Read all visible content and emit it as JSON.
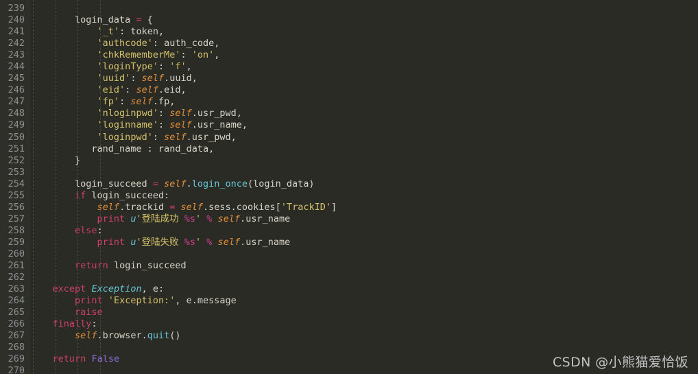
{
  "editor": {
    "language": "Python",
    "theme": {
      "background": "#2b2b26",
      "gutter_background": "#2f2f2a",
      "line_number_color": "#8e9191",
      "default_text": "#d7d4c8",
      "keyword": "#cc3f6a",
      "string": "#d3c16a",
      "self_keyword": "#e08f3c",
      "function_call": "#66c6d6",
      "class_name": "#66c6d6",
      "constant": "#8b6bd6",
      "format_spec": "#cc3f8a",
      "indent_guide": "#4a4a42"
    },
    "first_line_number": 239,
    "last_line_number": 270,
    "indent_guide_columns": [
      0,
      4,
      8,
      12
    ]
  },
  "lines": [
    {
      "number": "239",
      "tokens": []
    },
    {
      "number": "240",
      "tokens": [
        {
          "t": "        ",
          "c": "t-plain"
        },
        {
          "t": "login_data ",
          "c": "t-plain"
        },
        {
          "t": "=",
          "c": "t-op"
        },
        {
          "t": " {",
          "c": "t-plain"
        }
      ]
    },
    {
      "number": "241",
      "tokens": [
        {
          "t": "            ",
          "c": "t-plain"
        },
        {
          "t": "'_t'",
          "c": "t-str"
        },
        {
          "t": ": token,",
          "c": "t-plain"
        }
      ]
    },
    {
      "number": "242",
      "tokens": [
        {
          "t": "            ",
          "c": "t-plain"
        },
        {
          "t": "'authcode'",
          "c": "t-str"
        },
        {
          "t": ": auth_code,",
          "c": "t-plain"
        }
      ]
    },
    {
      "number": "243",
      "tokens": [
        {
          "t": "            ",
          "c": "t-plain"
        },
        {
          "t": "'chkRememberMe'",
          "c": "t-str"
        },
        {
          "t": ": ",
          "c": "t-plain"
        },
        {
          "t": "'on'",
          "c": "t-str"
        },
        {
          "t": ",",
          "c": "t-plain"
        }
      ]
    },
    {
      "number": "244",
      "tokens": [
        {
          "t": "            ",
          "c": "t-plain"
        },
        {
          "t": "'loginType'",
          "c": "t-str"
        },
        {
          "t": ": ",
          "c": "t-plain"
        },
        {
          "t": "'f'",
          "c": "t-str"
        },
        {
          "t": ",",
          "c": "t-plain"
        }
      ]
    },
    {
      "number": "245",
      "tokens": [
        {
          "t": "            ",
          "c": "t-plain"
        },
        {
          "t": "'uuid'",
          "c": "t-str"
        },
        {
          "t": ": ",
          "c": "t-plain"
        },
        {
          "t": "self",
          "c": "t-self"
        },
        {
          "t": ".uuid,",
          "c": "t-plain"
        }
      ]
    },
    {
      "number": "246",
      "tokens": [
        {
          "t": "            ",
          "c": "t-plain"
        },
        {
          "t": "'eid'",
          "c": "t-str"
        },
        {
          "t": ": ",
          "c": "t-plain"
        },
        {
          "t": "self",
          "c": "t-self"
        },
        {
          "t": ".eid,",
          "c": "t-plain"
        }
      ]
    },
    {
      "number": "247",
      "tokens": [
        {
          "t": "            ",
          "c": "t-plain"
        },
        {
          "t": "'fp'",
          "c": "t-str"
        },
        {
          "t": ": ",
          "c": "t-plain"
        },
        {
          "t": "self",
          "c": "t-self"
        },
        {
          "t": ".fp,",
          "c": "t-plain"
        }
      ]
    },
    {
      "number": "248",
      "tokens": [
        {
          "t": "            ",
          "c": "t-plain"
        },
        {
          "t": "'nloginpwd'",
          "c": "t-str"
        },
        {
          "t": ": ",
          "c": "t-plain"
        },
        {
          "t": "self",
          "c": "t-self"
        },
        {
          "t": ".usr_pwd,",
          "c": "t-plain"
        }
      ]
    },
    {
      "number": "249",
      "tokens": [
        {
          "t": "            ",
          "c": "t-plain"
        },
        {
          "t": "'loginname'",
          "c": "t-str"
        },
        {
          "t": ": ",
          "c": "t-plain"
        },
        {
          "t": "self",
          "c": "t-self"
        },
        {
          "t": ".usr_name,",
          "c": "t-plain"
        }
      ]
    },
    {
      "number": "250",
      "tokens": [
        {
          "t": "            ",
          "c": "t-plain"
        },
        {
          "t": "'loginpwd'",
          "c": "t-str"
        },
        {
          "t": ": ",
          "c": "t-plain"
        },
        {
          "t": "self",
          "c": "t-self"
        },
        {
          "t": ".usr_pwd,",
          "c": "t-plain"
        }
      ]
    },
    {
      "number": "251",
      "tokens": [
        {
          "t": "           rand_name : rand_data,",
          "c": "t-plain"
        }
      ]
    },
    {
      "number": "252",
      "tokens": [
        {
          "t": "        }",
          "c": "t-plain"
        }
      ]
    },
    {
      "number": "253",
      "tokens": []
    },
    {
      "number": "254",
      "tokens": [
        {
          "t": "        login_succeed ",
          "c": "t-plain"
        },
        {
          "t": "=",
          "c": "t-op"
        },
        {
          "t": " ",
          "c": "t-plain"
        },
        {
          "t": "self",
          "c": "t-self"
        },
        {
          "t": ".",
          "c": "t-plain"
        },
        {
          "t": "login_once",
          "c": "t-fn"
        },
        {
          "t": "(login_data)",
          "c": "t-plain"
        }
      ]
    },
    {
      "number": "255",
      "tokens": [
        {
          "t": "        ",
          "c": "t-plain"
        },
        {
          "t": "if",
          "c": "t-kw"
        },
        {
          "t": " login_succeed:",
          "c": "t-plain"
        }
      ]
    },
    {
      "number": "256",
      "tokens": [
        {
          "t": "            ",
          "c": "t-plain"
        },
        {
          "t": "self",
          "c": "t-self"
        },
        {
          "t": ".trackid ",
          "c": "t-plain"
        },
        {
          "t": "=",
          "c": "t-op"
        },
        {
          "t": " ",
          "c": "t-plain"
        },
        {
          "t": "self",
          "c": "t-self"
        },
        {
          "t": ".sess.cookies[",
          "c": "t-plain"
        },
        {
          "t": "'TrackID'",
          "c": "t-str"
        },
        {
          "t": "]",
          "c": "t-plain"
        }
      ]
    },
    {
      "number": "257",
      "tokens": [
        {
          "t": "            ",
          "c": "t-plain"
        },
        {
          "t": "print",
          "c": "t-kw"
        },
        {
          "t": " ",
          "c": "t-plain"
        },
        {
          "t": "u",
          "c": "t-uprefix"
        },
        {
          "t": "'",
          "c": "t-str"
        },
        {
          "t": "登陆成功",
          "c": "t-str t-cjk"
        },
        {
          "t": " ",
          "c": "t-str"
        },
        {
          "t": "%s",
          "c": "t-fmt"
        },
        {
          "t": "'",
          "c": "t-str"
        },
        {
          "t": " ",
          "c": "t-plain"
        },
        {
          "t": "%",
          "c": "t-fmt"
        },
        {
          "t": " ",
          "c": "t-plain"
        },
        {
          "t": "self",
          "c": "t-self"
        },
        {
          "t": ".usr_name",
          "c": "t-plain"
        }
      ]
    },
    {
      "number": "258",
      "tokens": [
        {
          "t": "        ",
          "c": "t-plain"
        },
        {
          "t": "else",
          "c": "t-kw"
        },
        {
          "t": ":",
          "c": "t-plain"
        }
      ]
    },
    {
      "number": "259",
      "tokens": [
        {
          "t": "            ",
          "c": "t-plain"
        },
        {
          "t": "print",
          "c": "t-kw"
        },
        {
          "t": " ",
          "c": "t-plain"
        },
        {
          "t": "u",
          "c": "t-uprefix"
        },
        {
          "t": "'",
          "c": "t-str"
        },
        {
          "t": "登陆失败",
          "c": "t-str t-cjk"
        },
        {
          "t": " ",
          "c": "t-str"
        },
        {
          "t": "%s",
          "c": "t-fmt"
        },
        {
          "t": "'",
          "c": "t-str"
        },
        {
          "t": " ",
          "c": "t-plain"
        },
        {
          "t": "%",
          "c": "t-fmt"
        },
        {
          "t": " ",
          "c": "t-plain"
        },
        {
          "t": "self",
          "c": "t-self"
        },
        {
          "t": ".usr_name",
          "c": "t-plain"
        }
      ]
    },
    {
      "number": "260",
      "tokens": []
    },
    {
      "number": "261",
      "tokens": [
        {
          "t": "        ",
          "c": "t-plain"
        },
        {
          "t": "return",
          "c": "t-kw"
        },
        {
          "t": " login_succeed",
          "c": "t-plain"
        }
      ]
    },
    {
      "number": "262",
      "tokens": []
    },
    {
      "number": "263",
      "tokens": [
        {
          "t": "    ",
          "c": "t-plain"
        },
        {
          "t": "except",
          "c": "t-kw"
        },
        {
          "t": " ",
          "c": "t-plain"
        },
        {
          "t": "Exception",
          "c": "t-cls"
        },
        {
          "t": ", e:",
          "c": "t-plain"
        }
      ]
    },
    {
      "number": "264",
      "tokens": [
        {
          "t": "        ",
          "c": "t-plain"
        },
        {
          "t": "print",
          "c": "t-kw"
        },
        {
          "t": " ",
          "c": "t-plain"
        },
        {
          "t": "'Exception:'",
          "c": "t-str"
        },
        {
          "t": ", e.message",
          "c": "t-plain"
        }
      ]
    },
    {
      "number": "265",
      "tokens": [
        {
          "t": "        ",
          "c": "t-plain"
        },
        {
          "t": "raise",
          "c": "t-kw"
        }
      ]
    },
    {
      "number": "266",
      "tokens": [
        {
          "t": "    ",
          "c": "t-plain"
        },
        {
          "t": "finally",
          "c": "t-kw"
        },
        {
          "t": ":",
          "c": "t-plain"
        }
      ]
    },
    {
      "number": "267",
      "tokens": [
        {
          "t": "        ",
          "c": "t-plain"
        },
        {
          "t": "self",
          "c": "t-self"
        },
        {
          "t": ".browser.",
          "c": "t-plain"
        },
        {
          "t": "quit",
          "c": "t-fn"
        },
        {
          "t": "()",
          "c": "t-plain"
        }
      ]
    },
    {
      "number": "268",
      "tokens": []
    },
    {
      "number": "269",
      "tokens": [
        {
          "t": "    ",
          "c": "t-plain"
        },
        {
          "t": "return",
          "c": "t-kw"
        },
        {
          "t": " ",
          "c": "t-plain"
        },
        {
          "t": "False",
          "c": "t-const"
        }
      ]
    },
    {
      "number": "270",
      "tokens": []
    }
  ],
  "watermark": {
    "text": "CSDN @小熊猫爱恰饭"
  }
}
